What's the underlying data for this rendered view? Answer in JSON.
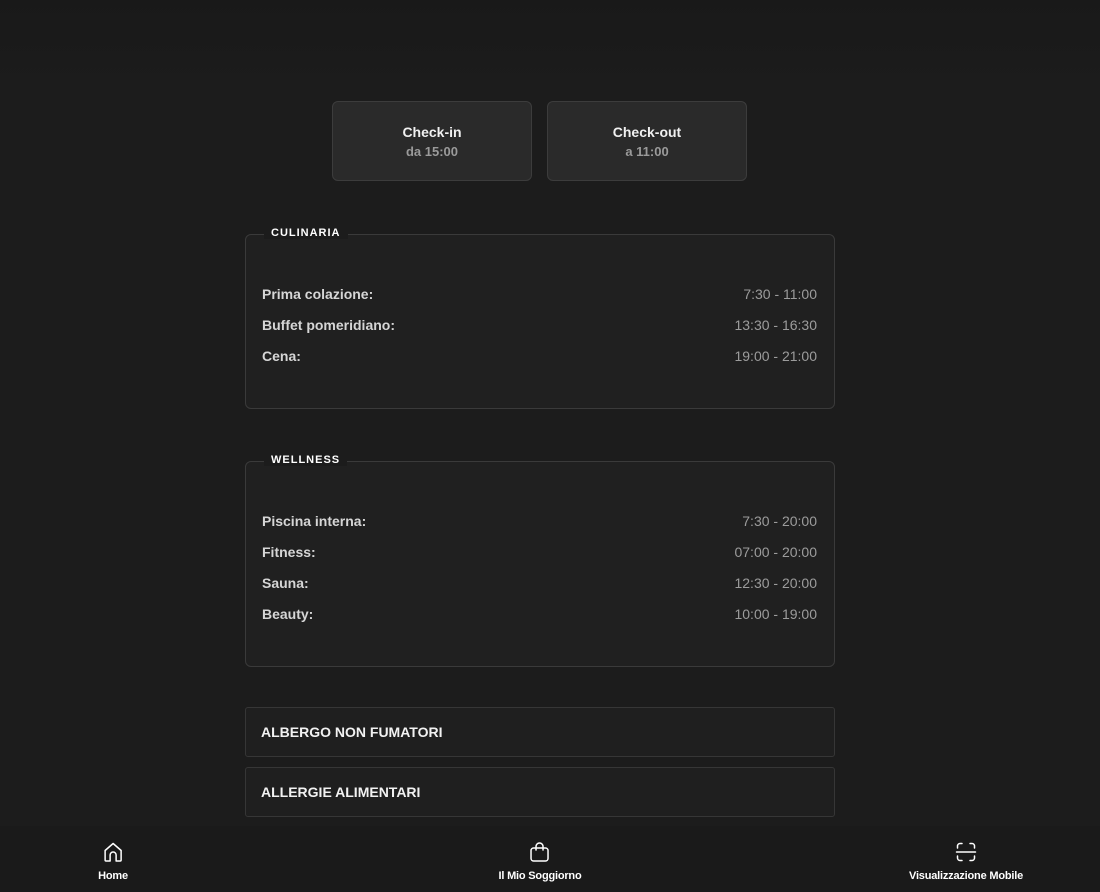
{
  "times": {
    "checkin": {
      "label": "Check-in",
      "value": "da 15:00"
    },
    "checkout": {
      "label": "Check-out",
      "value": "a 11:00"
    }
  },
  "sections": {
    "culinaria": {
      "title": "CULINARIA",
      "rows": [
        {
          "name": "Prima colazione:",
          "hours": "7:30 - 11:00"
        },
        {
          "name": "Buffet pomeridiano:",
          "hours": "13:30 - 16:30"
        },
        {
          "name": "Cena:",
          "hours": "19:00 - 21:00"
        }
      ]
    },
    "wellness": {
      "title": "WELLNESS",
      "rows": [
        {
          "name": "Piscina interna:",
          "hours": "7:30 - 20:00"
        },
        {
          "name": "Fitness:",
          "hours": "07:00 - 20:00"
        },
        {
          "name": "Sauna:",
          "hours": "12:30 - 20:00"
        },
        {
          "name": "Beauty:",
          "hours": "10:00 - 19:00"
        }
      ]
    }
  },
  "accordions": [
    {
      "title": "ALBERGO NON FUMATORI"
    },
    {
      "title": "ALLERGIE ALIMENTARI"
    }
  ],
  "nav": {
    "home": {
      "label": "Home",
      "icon": "home-icon"
    },
    "stay": {
      "label": "Il Mio Soggiorno",
      "icon": "bag-icon"
    },
    "mobile": {
      "label": "Visualizzazione Mobile",
      "icon": "scan-icon"
    }
  },
  "colors": {
    "background": "#1c1c1c",
    "card": "#2a2a2a",
    "text": "#ffffff",
    "muted": "#9c9c9c"
  }
}
